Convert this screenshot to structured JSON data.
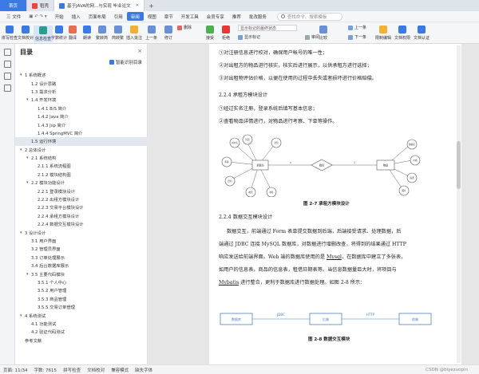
{
  "tabs": {
    "home": "首页",
    "docer": "稻壳",
    "doc": "基于JAVA的网...与实现 毕业论文"
  },
  "menu": {
    "file": "三 文件",
    "items": [
      "开始",
      "插入",
      "页面布局",
      "引用",
      "审阅",
      "视图",
      "章节",
      "开发工具",
      "会员专享",
      "推荐",
      "批改服务"
    ],
    "active_index": 4,
    "search_placeholder": "查找命令、搜索模板"
  },
  "ribbon": {
    "big": [
      "拼写检查",
      "文档校对",
      "信息检查",
      "字数统计",
      "翻译",
      "朗读",
      "繁转简",
      "简转繁",
      "插入批注",
      "上一条",
      "修订",
      "接受",
      "拒绝",
      "比较",
      "限制编辑",
      "文档权限",
      "文档认证"
    ],
    "small": {
      "delete": "删除",
      "prev": "上一条",
      "next": "下一条",
      "show_markup": "显示标记",
      "review": "审阅",
      "display_mode": "显示标记的最终状态"
    }
  },
  "toc": {
    "title": "目录",
    "smart": "智能识别目录",
    "items": [
      {
        "text": "1 系统概述",
        "level": 1,
        "arrow": "▾"
      },
      {
        "text": "1.2 设计思路",
        "level": 2,
        "arrow": ""
      },
      {
        "text": "1.3 需求分析",
        "level": 2,
        "arrow": ""
      },
      {
        "text": "1.4 开发环境",
        "level": 2,
        "arrow": "▾"
      },
      {
        "text": "1.4.1 B/S 简介",
        "level": 3,
        "arrow": ""
      },
      {
        "text": "1.4.2 Java 简介",
        "level": 3,
        "arrow": ""
      },
      {
        "text": "1.4.3 Jsp 简介",
        "level": 3,
        "arrow": ""
      },
      {
        "text": "1.4.4 SpringMVC 简介",
        "level": 3,
        "arrow": ""
      },
      {
        "text": "1.5 运行环境",
        "level": 2,
        "arrow": "",
        "selected": true
      },
      {
        "text": "2 总体设计",
        "level": 1,
        "arrow": "▾"
      },
      {
        "text": "2.1 系统结构",
        "level": 2,
        "arrow": "▾"
      },
      {
        "text": "2.1.1 系统流程图",
        "level": 3,
        "arrow": ""
      },
      {
        "text": "2.1.2 模块结构图",
        "level": 3,
        "arrow": ""
      },
      {
        "text": "2.2 模块功能设计",
        "level": 2,
        "arrow": "▾"
      },
      {
        "text": "2.2.1 登录模块设计",
        "level": 3,
        "arrow": ""
      },
      {
        "text": "2.2.2 出租方模块设计",
        "level": 3,
        "arrow": ""
      },
      {
        "text": "2.2.3 交易平台模块设计",
        "level": 3,
        "arrow": ""
      },
      {
        "text": "2.2.4 承租方模块设计",
        "level": 3,
        "arrow": ""
      },
      {
        "text": "2.2.4 数据交互模块设计",
        "level": 3,
        "arrow": ""
      },
      {
        "text": "3 设计设计",
        "level": 1,
        "arrow": "▾"
      },
      {
        "text": "3.1 用户界面",
        "level": 2,
        "arrow": ""
      },
      {
        "text": "3.2 管理员界面",
        "level": 2,
        "arrow": ""
      },
      {
        "text": "3.3 订单处理展示",
        "level": 2,
        "arrow": ""
      },
      {
        "text": "3.4 后台数据库展示",
        "level": 2,
        "arrow": ""
      },
      {
        "text": "3.5 主要代码模块",
        "level": 2,
        "arrow": "▾"
      },
      {
        "text": "3.5.1 个人中心",
        "level": 3,
        "arrow": ""
      },
      {
        "text": "3.5.2 用户管理",
        "level": 3,
        "arrow": ""
      },
      {
        "text": "3.5.3 商品管理",
        "level": 3,
        "arrow": ""
      },
      {
        "text": "3.5.5 交易订单管理",
        "level": 3,
        "arrow": ""
      },
      {
        "text": "4 系统测试",
        "level": 1,
        "arrow": "▾"
      },
      {
        "text": "4.1 功能测试",
        "level": 2,
        "arrow": ""
      },
      {
        "text": "4.2 验证代码测试",
        "level": 2,
        "arrow": ""
      },
      {
        "text": "参考文献",
        "level": 1,
        "arrow": ""
      }
    ]
  },
  "doc": {
    "l1": "①对注册信息进行校对，确保用户帐号的唯一性；",
    "l2": "②对出租方的物品进行核实，核实后进行展示，以供承租方进行选择；",
    "l3": "③对出租物评估价格，以便在使用的过程中丢失或者损坏进行价格赔偿。",
    "h1": "2.2.4 承租方模块设计",
    "l4": "①经过实名注册，登录系统后填写基本信息；",
    "l5": "②查看物品详情进行，对物品进行考察、下单等操作。",
    "fig1_caption": "图 2-7 承租方模块设计",
    "fig1_labels": {
      "left_entity": "承租方",
      "relation": "租赁",
      "right_entity": "物品",
      "many": "n",
      "one": "1",
      "attrs_left": [
        "用户名",
        "性别",
        "年龄",
        "密码",
        "电话",
        "地址",
        "身份"
      ],
      "attrs_right": [
        "物品名",
        "价格",
        "描述",
        "图片"
      ]
    },
    "h2": "2.2.4 数据交互模块设计",
    "para": [
      "数据交互，前端通过 Form 表单提交数据到后端，后端接受请求、处理数据，后",
      "端通过 JDBC 连接 MySQL 数据库，对数据进行增删改查，将得到的结果通过 HTTP",
      "响应发送给前端界面。Web 端的数据库使用的是 ",
      "，在数据库中建立了多张表，",
      "如用户的信息表，商品的信息表，租借日期表等。当信息数据量巨大时，将项目与",
      "Mybatis",
      " 进行整合，更利于数据库进行数据处理。如图 2-8 所示："
    ],
    "mysql": "Mysql",
    "fig2": {
      "n1": "数据库",
      "n2": "后端",
      "n3": "前端",
      "e1": "JDBC",
      "e2": "HTTP"
    },
    "fig2_caption": "图 2-8 数据交互模块"
  },
  "status": {
    "page": "页面: 11/34",
    "words": "字数: 7615",
    "spell": "拼写检查",
    "proof": "文档校对",
    "compat": "兼容模式",
    "font_missing": "缺失字体",
    "watermark": "CSDN @biyezuopin"
  },
  "colors": {
    "accent": "#3b7ae6",
    "flow_box": "#4a7fc9"
  }
}
